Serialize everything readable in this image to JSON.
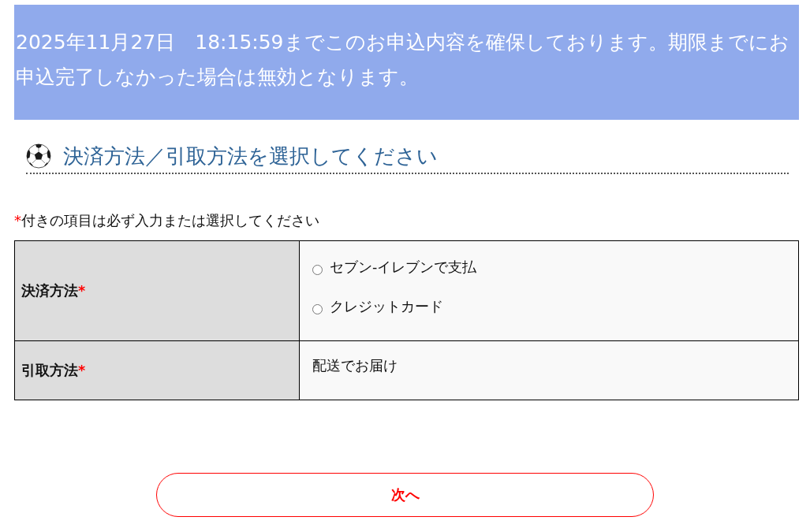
{
  "notice": {
    "text": "2025年11月27日　18:15:59までこのお申込内容を確保しております。期限までにお申込完了しなかった場合は無効となります。"
  },
  "section_heading": {
    "text": "決済方法／引取方法を選択してください"
  },
  "required_note": {
    "mark": "*",
    "text": "付きの項目は必ず入力または選択してください"
  },
  "form_rows": [
    {
      "kind": "radio_group",
      "label": "決済方法",
      "required_mark": "*",
      "options": [
        {
          "label": "セブン-イレブンで支払",
          "selected": false
        },
        {
          "label": "クレジットカード",
          "selected": false
        }
      ]
    },
    {
      "kind": "static",
      "label": "引取方法",
      "required_mark": "*",
      "value": "配送でお届け"
    }
  ],
  "next_button": {
    "label": "次へ"
  }
}
